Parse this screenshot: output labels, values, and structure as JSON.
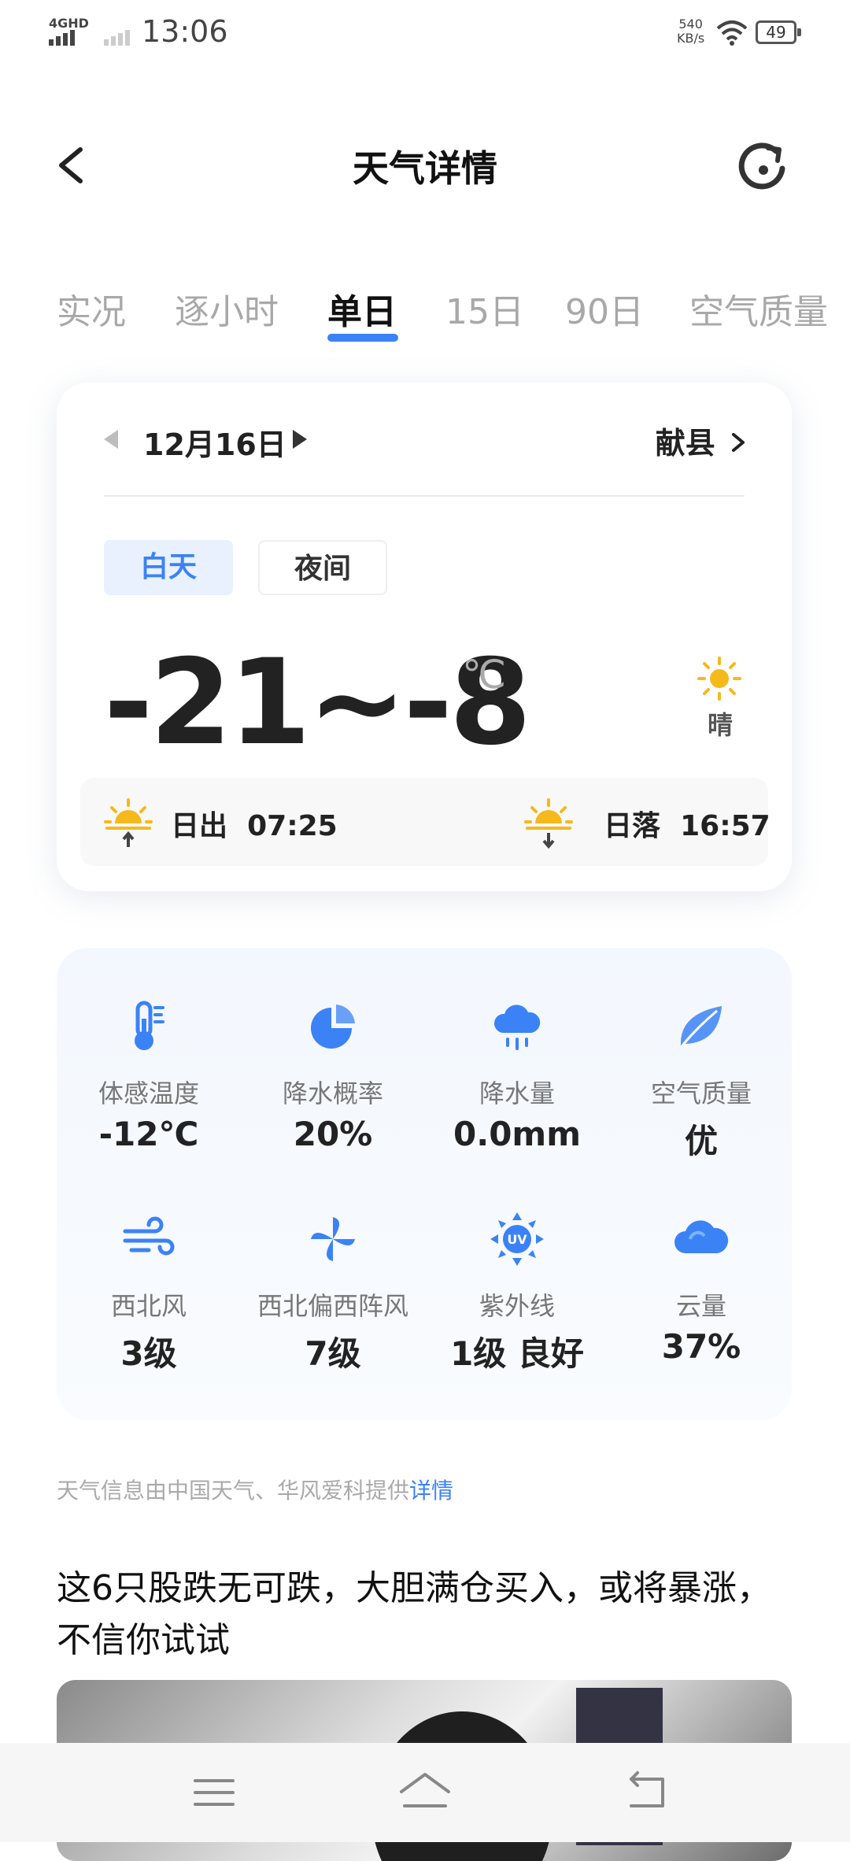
{
  "status_bar": {
    "network": "4GHD",
    "time": "13:06",
    "speed_value": "540",
    "speed_unit": "KB/s",
    "battery": "49"
  },
  "header": {
    "title": "天气详情",
    "back_icon": "back-arrow-icon",
    "refresh_icon": "refresh-icon"
  },
  "tabs": [
    {
      "label": "实况",
      "active": false
    },
    {
      "label": "逐小时",
      "active": false
    },
    {
      "label": "单日",
      "active": true
    },
    {
      "label": "15日",
      "active": false
    },
    {
      "label": "90日",
      "active": false
    },
    {
      "label": "空气质量",
      "active": false
    }
  ],
  "day_card": {
    "date": "12月16日",
    "city": "献县",
    "segments": {
      "day": "白天",
      "night": "夜间"
    },
    "temperature_range": "-21~-8",
    "unit": "℃",
    "condition": "晴",
    "sunrise": {
      "label": "日出",
      "time": "07:25"
    },
    "sunset": {
      "label": "日落",
      "time": "16:57"
    }
  },
  "details": [
    {
      "icon": "thermometer-icon",
      "label": "体感温度",
      "value": "-12℃"
    },
    {
      "icon": "pie-chart-icon",
      "label": "降水概率",
      "value": "20%"
    },
    {
      "icon": "rain-cloud-icon",
      "label": "降水量",
      "value": "0.0mm"
    },
    {
      "icon": "leaf-icon",
      "label": "空气质量",
      "value": "优"
    },
    {
      "icon": "wind-icon",
      "label": "西北风",
      "value": "3级"
    },
    {
      "icon": "pinwheel-icon",
      "label": "西北偏西阵风",
      "value": "7级"
    },
    {
      "icon": "uv-icon",
      "label": "紫外线",
      "value": "1级 良好"
    },
    {
      "icon": "cloud-icon",
      "label": "云量",
      "value": "37%"
    }
  ],
  "source": {
    "text": "天气信息由中国天气、华风爱科提供",
    "link": "详情"
  },
  "news": {
    "title": "这6只股跌无可跌，大胆满仓买入，或将暴涨，不信你试试"
  },
  "colors": {
    "accent": "#3b82f6",
    "sun": "#f6b91c"
  }
}
